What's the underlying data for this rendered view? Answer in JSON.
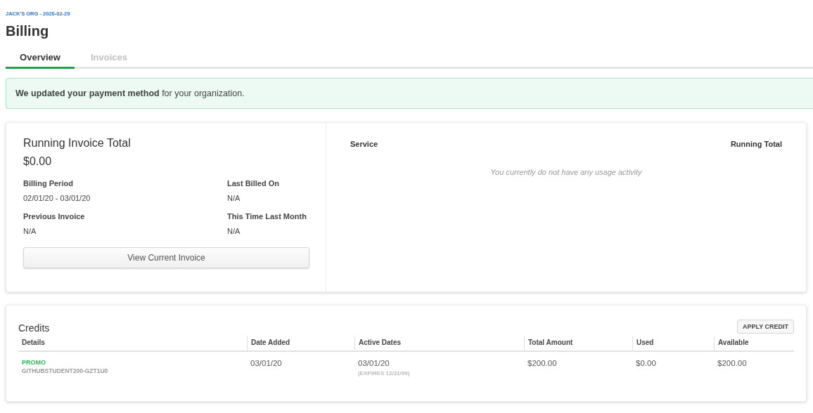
{
  "breadcrumb": "JACK'S ORG - 2020-02-29",
  "title": "Billing",
  "tabs": [
    {
      "label": "Overview",
      "selected": true
    },
    {
      "label": "Invoices",
      "selected": false
    }
  ],
  "banner": {
    "text": "**We updated your payment method** for your organization."
  },
  "summary": {
    "title": "Running Invoice Total",
    "total": "$0.00",
    "stats": [
      {
        "label": "Billing Period",
        "value": "02/01/20 - 03/01/20"
      },
      {
        "label": "Last Billed On",
        "value": "N/A"
      },
      {
        "label": "Previous Invoice",
        "value": "N/A"
      },
      {
        "label": "This Time Last Month",
        "value": "N/A"
      }
    ],
    "button": "View Current Invoice"
  },
  "usage": {
    "columns": [
      "Service",
      "Running Total"
    ],
    "empty": "You currently do not have any usage activity"
  },
  "credits": {
    "title": "Credits",
    "button": "APPLY CREDIT",
    "columns": [
      "Details",
      "Date Added",
      "Active Dates",
      "Total Amount",
      "Used",
      "Available"
    ],
    "rows": [
      {
        "type": "PROMO",
        "code": "GITHUBSTUDENT200-GZT1U0",
        "date_added": "03/01/20",
        "active_from": "03/01/20",
        "expires_label": "(EXPIRES",
        "expires": "12/31/99)",
        "total": "$200.00",
        "used": "$0.00",
        "available": "$200.00"
      }
    ]
  }
}
